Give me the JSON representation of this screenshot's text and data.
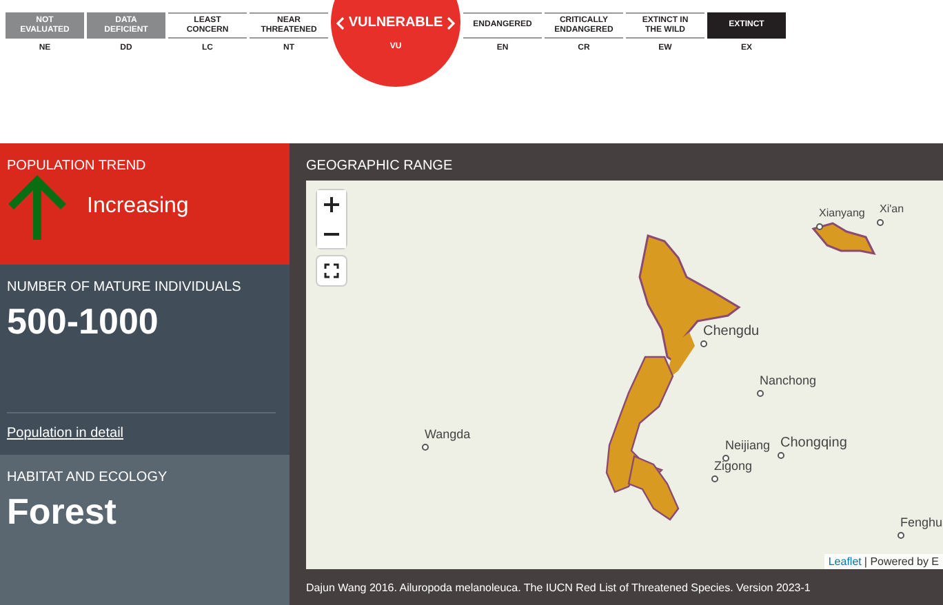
{
  "status_scale": [
    {
      "label": "NOT EVALUATED",
      "code": "NE",
      "kind": "grey",
      "selected": false
    },
    {
      "label": "DATA DEFICIENT",
      "code": "DD",
      "kind": "grey",
      "selected": false
    },
    {
      "label": "LEAST CONCERN",
      "code": "LC",
      "kind": "plain",
      "selected": false
    },
    {
      "label": "NEAR THREATENED",
      "code": "NT",
      "kind": "plain",
      "selected": false
    },
    {
      "label": "VULNERABLE",
      "code": "VU",
      "selected": true
    },
    {
      "label": "ENDANGERED",
      "code": "EN",
      "kind": "plain",
      "selected": false
    },
    {
      "label": "CRITICALLY ENDANGERED",
      "code": "CR",
      "kind": "plain",
      "selected": false
    },
    {
      "label": "EXTINCT IN THE WILD",
      "code": "EW",
      "kind": "plain",
      "selected": false
    },
    {
      "label": "EXTINCT",
      "code": "EX",
      "kind": "dark",
      "selected": false
    }
  ],
  "population_trend": {
    "heading": "POPULATION TREND",
    "value": "Increasing"
  },
  "mature_individuals": {
    "heading": "NUMBER OF MATURE INDIVIDUALS",
    "value": "500-1000",
    "link": "Population in detail"
  },
  "habitat": {
    "heading": "HABITAT AND ECOLOGY",
    "value": "Forest"
  },
  "geographic_range": {
    "heading": "GEOGRAPHIC RANGE",
    "places": [
      "Xianyang",
      "Xi'an",
      "Chengdu",
      "Nanchong",
      "Neijiang",
      "Chongqing",
      "Zigong",
      "Wangda",
      "Fenghu"
    ],
    "attribution_link": "Leaflet",
    "attribution_text": "| Powered by E",
    "caption": "Dajun Wang 2016. Ailuropoda melanoleuca. The IUCN Red List of Threatened Species. Version 2023-1"
  }
}
